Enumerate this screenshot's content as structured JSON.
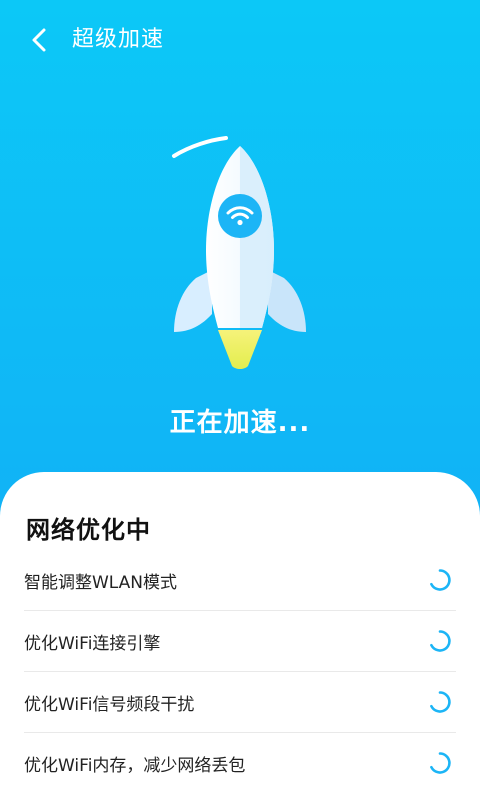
{
  "header": {
    "title": "超级加速",
    "back_icon": "chevron-left-icon"
  },
  "main": {
    "status_text": "正在加速...",
    "rocket_icon": "rocket-icon",
    "wifi_icon": "wifi-icon"
  },
  "card": {
    "title": "网络优化中",
    "tasks": [
      {
        "label": "智能调整WLAN模式",
        "icon": "loading-spinner-icon"
      },
      {
        "label": "优化WiFi连接引擎",
        "icon": "loading-spinner-icon"
      },
      {
        "label": "优化WiFi信号频段干扰",
        "icon": "loading-spinner-icon"
      },
      {
        "label": "优化WiFi内存，减少网络丢包",
        "icon": "loading-spinner-icon"
      }
    ]
  },
  "colors": {
    "background_top": "#0CC8F7",
    "background_bottom": "#16A4F5",
    "accent": "#1CB5F6",
    "flame": "#F2F25A"
  }
}
